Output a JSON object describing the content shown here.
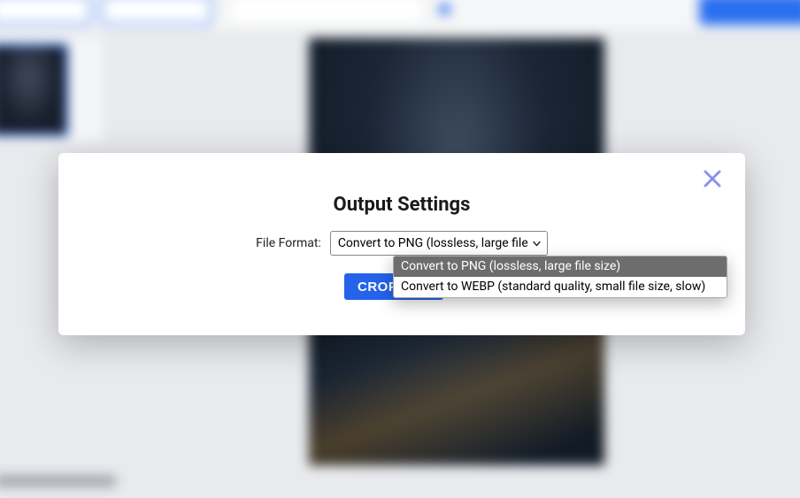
{
  "modal": {
    "title": "Output Settings",
    "file_format_label": "File Format:",
    "crop_button": "CROP",
    "selected_option": "Convert to PNG (lossless, large file size)",
    "options": [
      "Convert to PNG (lossless, large file size)",
      "Convert to WEBP (standard quality, small file size, slow)"
    ]
  },
  "colors": {
    "accent": "#2563eb",
    "close_x": "#8e7bd6"
  }
}
